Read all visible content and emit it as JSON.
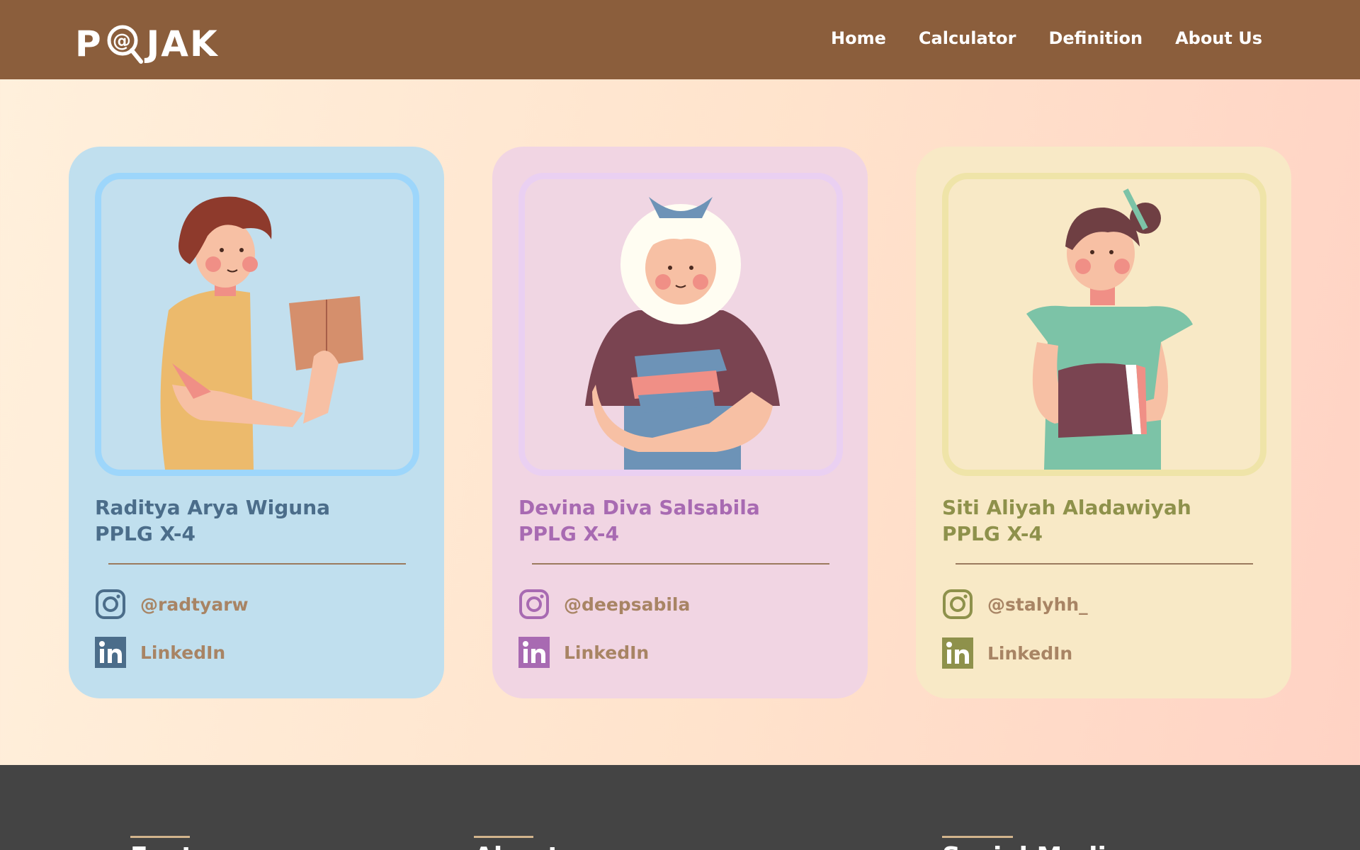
{
  "nav": {
    "logo_letters": [
      "P",
      "JAK"
    ],
    "links": [
      "Home",
      "Calculator",
      "Definition",
      "About Us"
    ]
  },
  "cards": [
    {
      "name": "Raditya Arya Wiguna",
      "class": "PPLG X-4",
      "instagram": "@radtyarw",
      "linkedin": "LinkedIn",
      "accent": "#4b6d8a",
      "background": "#c0dfee"
    },
    {
      "name": "Devina Diva Salsabila",
      "class": "PPLG X-4",
      "instagram": "@deepsabila",
      "linkedin": "LinkedIn",
      "accent": "#a86ab2",
      "background": "#f1d5e3"
    },
    {
      "name": "Siti Aliyah Aladawiyah",
      "class": "PPLG X-4",
      "instagram": "@stalyhh_",
      "linkedin": "LinkedIn",
      "accent": "#8e914b",
      "background": "#f8e9c6"
    }
  ],
  "footer": {
    "columns": [
      "Featu",
      "About",
      "Social Media"
    ]
  },
  "colors": {
    "navbar": "#8b5e3c",
    "footer": "#444444",
    "link_text": "#a88464"
  }
}
